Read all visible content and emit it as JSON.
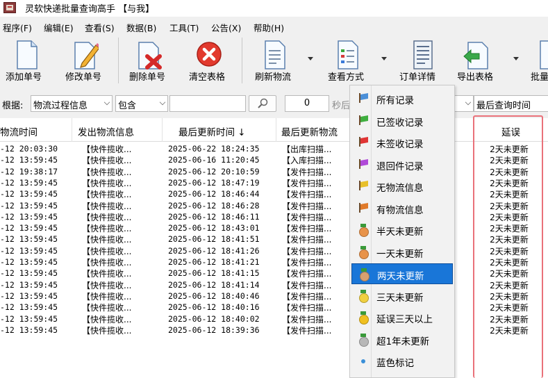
{
  "window": {
    "title": "灵软快递批量查询高手 【与我】"
  },
  "menu": [
    "程序(F)",
    "编辑(E)",
    "查看(S)",
    "数据(B)",
    "工具(T)",
    "公告(X)",
    "帮助(H)"
  ],
  "toolbar": {
    "add": "添加单号",
    "edit": "修改单号",
    "delete": "删除单号",
    "clear": "清空表格",
    "refresh": "刷新物流",
    "view_mode": "查看方式",
    "order_detail": "订单详情",
    "export": "导出表格",
    "batch": "批量"
  },
  "filter": {
    "by_label": "根据:",
    "field": "物流过程信息",
    "op": "包含",
    "keyword": "",
    "number": "0",
    "seconds_label": "秒后",
    "sort": "最后查询时间"
  },
  "columns": {
    "ship_time": "物流时间",
    "ship_info": "发出物流信息",
    "last_update": "最后更新时间 ↓",
    "last_info": "最后更新物流",
    "delay": "延误"
  },
  "rows": [
    {
      "t": "-12 20:03:30",
      "info": "【快件揽收...",
      "upd": "2025-06-22 18:24:35",
      "last": "【出库扫描...",
      "delay": "2天未更新"
    },
    {
      "t": "-12 13:59:45",
      "info": "【快件揽收...",
      "upd": "2025-06-16 11:20:45",
      "last": "【入库扫描...",
      "delay": "2天未更新"
    },
    {
      "t": "-12 19:38:17",
      "info": "【快件揽收...",
      "upd": "2025-06-12 20:10:59",
      "last": "【发件扫描...",
      "delay": "2天未更新"
    },
    {
      "t": "-12 13:59:45",
      "info": "【快件揽收...",
      "upd": "2025-06-12 18:47:19",
      "last": "【发件扫描...",
      "delay": "2天未更新"
    },
    {
      "t": "-12 13:59:45",
      "info": "【快件揽收...",
      "upd": "2025-06-12 18:46:44",
      "last": "【发件扫描...",
      "delay": "2天未更新"
    },
    {
      "t": "-12 13:59:45",
      "info": "【快件揽收...",
      "upd": "2025-06-12 18:46:28",
      "last": "【发件扫描...",
      "delay": "2天未更新"
    },
    {
      "t": "-12 13:59:45",
      "info": "【快件揽收...",
      "upd": "2025-06-12 18:46:11",
      "last": "【发件扫描...",
      "delay": "2天未更新"
    },
    {
      "t": "-12 13:59:45",
      "info": "【快件揽收...",
      "upd": "2025-06-12 18:43:01",
      "last": "【发件扫描...",
      "delay": "2天未更新"
    },
    {
      "t": "-12 13:59:45",
      "info": "【快件揽收...",
      "upd": "2025-06-12 18:41:51",
      "last": "【发件扫描...",
      "delay": "2天未更新"
    },
    {
      "t": "-12 13:59:45",
      "info": "【快件揽收...",
      "upd": "2025-06-12 18:41:26",
      "last": "【发件扫描...",
      "delay": "2天未更新"
    },
    {
      "t": "-12 13:59:45",
      "info": "【快件揽收...",
      "upd": "2025-06-12 18:41:21",
      "last": "【发件扫描...",
      "delay": "2天未更新"
    },
    {
      "t": "-12 13:59:45",
      "info": "【快件揽收...",
      "upd": "2025-06-12 18:41:15",
      "last": "【发件扫描...",
      "delay": "2天未更新"
    },
    {
      "t": "-12 13:59:45",
      "info": "【快件揽收...",
      "upd": "2025-06-12 18:41:14",
      "last": "【发件扫描...",
      "delay": "2天未更新"
    },
    {
      "t": "-12 13:59:45",
      "info": "【快件揽收...",
      "upd": "2025-06-12 18:40:46",
      "last": "【发件扫描...",
      "delay": "2天未更新"
    },
    {
      "t": "-12 13:59:45",
      "info": "【快件揽收...",
      "upd": "2025-06-12 18:40:16",
      "last": "【发件扫描...",
      "delay": "2天未更新"
    },
    {
      "t": "-12 13:59:45",
      "info": "【快件揽收...",
      "upd": "2025-06-12 18:40:02",
      "last": "【发件扫描...",
      "delay": "2天未更新"
    },
    {
      "t": "-12 13:59:45",
      "info": "【快件揽收...",
      "upd": "2025-06-12 18:39:36",
      "last": "【发件扫描...",
      "delay": "2天未更新"
    }
  ],
  "dropdown": {
    "items": [
      {
        "label": "所有记录",
        "icon": "flag-blue-icon",
        "color": "#4a8fd8"
      },
      {
        "label": "已签收记录",
        "icon": "flag-green-icon",
        "color": "#3fae3f"
      },
      {
        "label": "未签收记录",
        "icon": "flag-red-icon",
        "color": "#e03535"
      },
      {
        "label": "退回件记录",
        "icon": "flag-purple-icon",
        "color": "#b04ad8"
      },
      {
        "label": "无物流信息",
        "icon": "flag-yellow-icon",
        "color": "#e8c02a"
      },
      {
        "label": "有物流信息",
        "icon": "flag-orange-icon",
        "color": "#e07a2a"
      },
      {
        "label": "半天未更新",
        "icon": "medal-orange-icon",
        "color": "#e8934a"
      },
      {
        "label": "一天未更新",
        "icon": "medal-orange-icon",
        "color": "#e8934a"
      },
      {
        "label": "两天未更新",
        "icon": "medal-orange-icon",
        "color": "#d8a070",
        "selected": true
      },
      {
        "label": "三天未更新",
        "icon": "medal-yellow-icon",
        "color": "#f0d040"
      },
      {
        "label": "延误三天以上",
        "icon": "medal-yellow-icon",
        "color": "#f0c020"
      },
      {
        "label": "超1年未更新",
        "icon": "medal-gray-icon",
        "color": "#b8b8b8"
      },
      {
        "label": "蓝色标记",
        "icon": "blue-dot-icon",
        "color": "#3a8fd8"
      }
    ]
  }
}
